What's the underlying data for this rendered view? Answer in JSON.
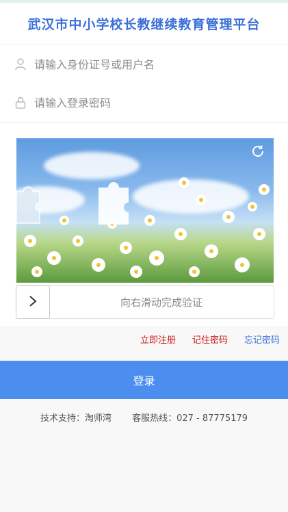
{
  "header": {
    "title": "武汉市中小学校长教继续教育管理平台"
  },
  "form": {
    "username_placeholder": "请输入身份证号或用户名",
    "password_placeholder": "请输入登录密码"
  },
  "captcha": {
    "slider_text": "向右滑动完成验证"
  },
  "links": {
    "register": "立即注册",
    "remember": "记住密码",
    "forgot": "忘记密码"
  },
  "login": {
    "label": "登录"
  },
  "footer": {
    "support": "技术支持：淘师湾",
    "hotline": "客服热线：027 - 87775179"
  },
  "colors": {
    "accent": "#4b8ef0",
    "title": "#3d6fd8",
    "link_red": "#c81818",
    "link_blue": "#3c6fd7"
  },
  "icons": {
    "user": "user-icon",
    "lock": "lock-icon",
    "refresh": "refresh-icon",
    "arrow": "chevron-right-icon"
  }
}
